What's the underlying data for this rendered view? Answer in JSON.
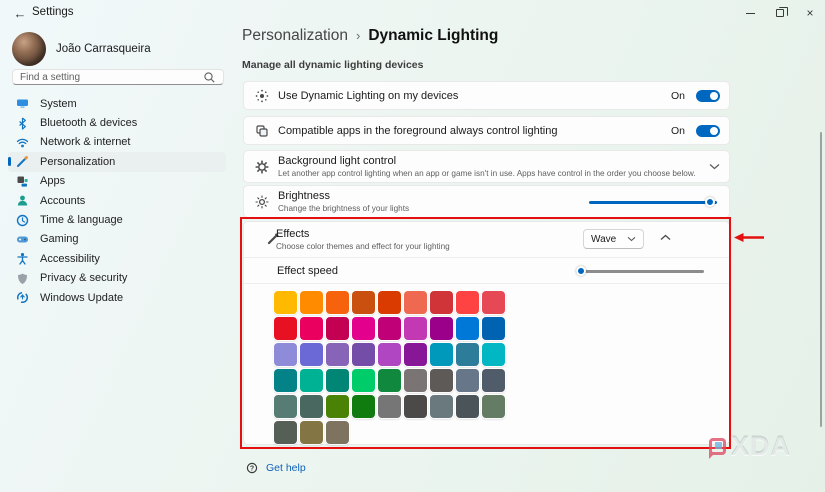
{
  "window": {
    "title": "Settings"
  },
  "sidebar": {
    "user_name": "João Carrasqueira",
    "search_placeholder": "Find a setting",
    "items": [
      {
        "label": "System"
      },
      {
        "label": "Bluetooth & devices"
      },
      {
        "label": "Network & internet"
      },
      {
        "label": "Personalization",
        "selected": true
      },
      {
        "label": "Apps"
      },
      {
        "label": "Accounts"
      },
      {
        "label": "Time & language"
      },
      {
        "label": "Gaming"
      },
      {
        "label": "Accessibility"
      },
      {
        "label": "Privacy & security"
      },
      {
        "label": "Windows Update"
      }
    ]
  },
  "breadcrumb": {
    "parent": "Personalization",
    "separator": "›",
    "current": "Dynamic Lighting"
  },
  "content": {
    "section_label": "Manage all dynamic lighting devices",
    "rows": {
      "use_dynamic": {
        "label": "Use Dynamic Lighting on my devices",
        "state": "On"
      },
      "compatible_apps": {
        "label": "Compatible apps in the foreground always control lighting",
        "state": "On"
      },
      "background_control": {
        "title": "Background light control",
        "subtitle": "Let another app control lighting when an app or game isn't in use. Apps have control in the order you choose below."
      },
      "brightness": {
        "title": "Brightness",
        "subtitle": "Change the brightness of your lights",
        "value_percent": 100
      },
      "effects": {
        "title": "Effects",
        "subtitle": "Choose color themes and effect for your lighting",
        "dropdown_value": "Wave"
      },
      "effect_speed": {
        "label": "Effect speed",
        "value_percent": 2
      }
    },
    "get_help": "Get help"
  },
  "palette": {
    "colors": [
      "#FFB900",
      "#FF8C00",
      "#F7630C",
      "#CA5010",
      "#DA3B01",
      "#EF6950",
      "#D13438",
      "#FF4343",
      "#E74856",
      "#E81123",
      "#EA005E",
      "#C30052",
      "#E3008C",
      "#BF0077",
      "#C239B3",
      "#9A0089",
      "#0078D7",
      "#0063B1",
      "#8E8CD8",
      "#6B69D6",
      "#8764B8",
      "#744DA9",
      "#B146C2",
      "#881798",
      "#0099BC",
      "#2D7D9A",
      "#00B7C3",
      "#038387",
      "#00B294",
      "#018574",
      "#00CC6A",
      "#10893E",
      "#7A7574",
      "#5D5A58",
      "#68768A",
      "#515C6B",
      "#567C73",
      "#486860",
      "#498205",
      "#107C10",
      "#767676",
      "#4C4A48",
      "#69797E",
      "#4A5459",
      "#647C64",
      "#555F56",
      "#847545",
      "#7E735F"
    ]
  },
  "watermark": {
    "text": "XDA"
  },
  "theme": {
    "accent": "#0067C0",
    "highlight_red": "#E60F0F"
  }
}
